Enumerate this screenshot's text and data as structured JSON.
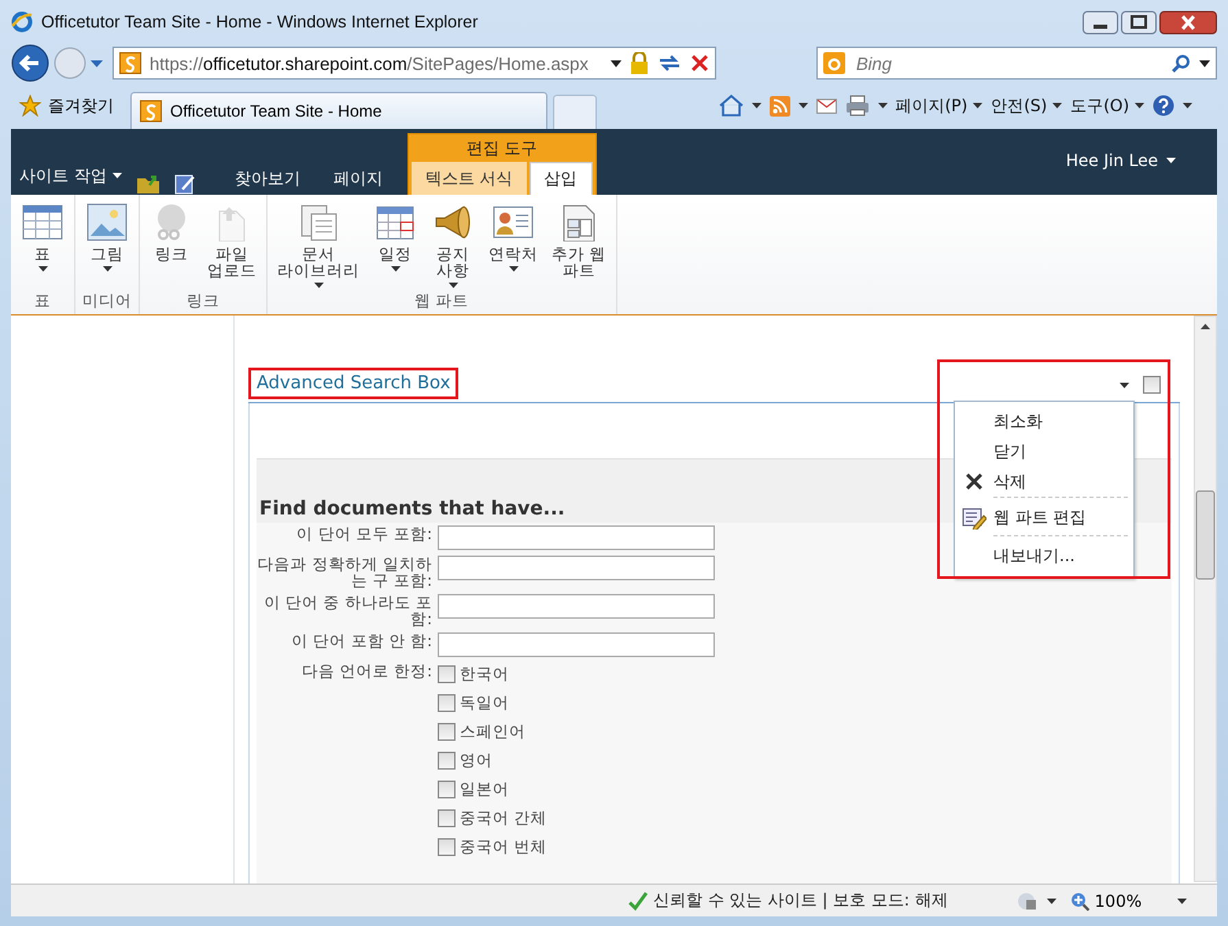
{
  "window": {
    "title": "Officetutor Team Site - Home - Windows Internet Explorer"
  },
  "address_bar": {
    "url_parts": [
      {
        "text": "https://",
        "emphasis": false
      },
      {
        "text": "officetutor",
        "emphasis": true
      },
      {
        "text": ".sharepoint.com",
        "emphasis": true
      },
      {
        "text": "/SitePages/Home.aspx",
        "emphasis": false
      }
    ]
  },
  "search": {
    "placeholder": "Bing"
  },
  "favorites_bar": {
    "favorites": "즐겨찾기",
    "tab_title": "Officetutor Team Site - Home"
  },
  "command_bar": {
    "items": [
      "페이지(P)",
      "안전(S)",
      "도구(O)"
    ]
  },
  "ribbon": {
    "site_actions": "사이트 작업",
    "context_group": "편집 도구",
    "user": "Hee Jin Lee",
    "tabs": [
      {
        "label": "찾아보기",
        "contextual": false,
        "selected": false
      },
      {
        "label": "페이지",
        "contextual": false,
        "selected": false
      },
      {
        "label": "텍스트 서식",
        "contextual": true,
        "selected": false
      },
      {
        "label": "삽입",
        "contextual": true,
        "selected": true
      }
    ],
    "groups": [
      {
        "label": "표",
        "buttons": [
          {
            "label": "표",
            "dropdown": true,
            "disabled": false
          }
        ]
      },
      {
        "label": "미디어",
        "buttons": [
          {
            "label": "그림",
            "dropdown": true,
            "disabled": false
          }
        ]
      },
      {
        "label": "링크",
        "buttons": [
          {
            "label": "링크",
            "dropdown": false,
            "disabled": true
          },
          {
            "label": "파일\n업로드",
            "dropdown": false,
            "disabled": true
          }
        ]
      },
      {
        "label": "웹 파트",
        "buttons": [
          {
            "label": "문서\n라이브러리",
            "dropdown": true,
            "disabled": false
          },
          {
            "label": "일정",
            "dropdown": true,
            "disabled": false
          },
          {
            "label": "공지\n사항",
            "dropdown": true,
            "disabled": false
          },
          {
            "label": "연락처",
            "dropdown": true,
            "disabled": false
          },
          {
            "label": "추가 웹\n파트",
            "dropdown": false,
            "disabled": false
          }
        ]
      }
    ]
  },
  "webpart": {
    "title": "Advanced Search Box",
    "title_highlighted": true,
    "menu_highlighted": true,
    "checked": false,
    "menu": [
      {
        "label": "최소화",
        "kind": "plain",
        "separator_before": false
      },
      {
        "label": "닫기",
        "kind": "plain",
        "separator_before": false
      },
      {
        "label": "삭제",
        "kind": "delete",
        "separator_before": false
      },
      {
        "label": "웹 파트 편집",
        "kind": "edit",
        "separator_before": true
      },
      {
        "label": "내보내기...",
        "kind": "plain",
        "separator_before": true
      }
    ],
    "heading": "Find documents that have...",
    "fields": [
      {
        "label": "이 단어 모두 포함:"
      },
      {
        "label": "다음과 정확하게 일치하는 구 포함:"
      },
      {
        "label": "이 단어 중 하나라도 포함:"
      },
      {
        "label": "이 단어 포함 안 함:"
      }
    ],
    "languages_label": "다음 언어로 한정:",
    "languages": [
      {
        "label": "한국어",
        "checked": false
      },
      {
        "label": "독일어",
        "checked": false
      },
      {
        "label": "스페인어",
        "checked": false
      },
      {
        "label": "영어",
        "checked": false
      },
      {
        "label": "일본어",
        "checked": false
      },
      {
        "label": "중국어 간체",
        "checked": false
      },
      {
        "label": "중국어 번체",
        "checked": false
      }
    ]
  },
  "status_bar": {
    "zone": "신뢰할 수 있는 사이트 | 보호 모드: 해제",
    "zoom": "100%"
  }
}
